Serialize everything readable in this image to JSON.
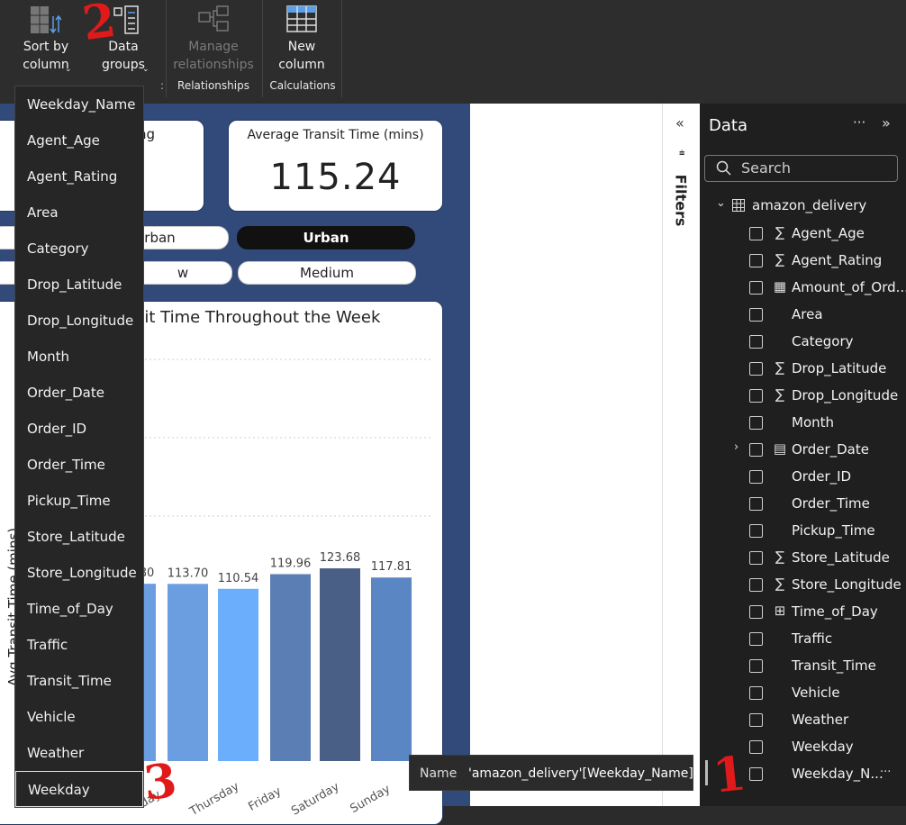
{
  "ribbon": {
    "sort_by_column": "Sort by\ncolumn",
    "data_groups": "Data\ngroups",
    "manage_relationships": "Manage\nrelationships",
    "new_column": "New\ncolumn",
    "group_relationships": "Relationships",
    "group_calculations": "Calculations"
  },
  "cards": {
    "rating_fragment": "ting",
    "avg_transit_title": "Average Transit Time (mins)",
    "avg_transit_value": "115.24"
  },
  "slicers": {
    "row1_left": "Urban",
    "row1_right": "Urban",
    "row2_left": "w",
    "row2_right": "Medium"
  },
  "chart": {
    "title_fragment": "sit Time Throughout the Week",
    "ylabel_fragment": "Avg Transit Time (mins)"
  },
  "chart_data": {
    "type": "bar",
    "title": "sit Time Throughout the Week",
    "ylabel": "Avg Transit Time (mins)",
    "categories": [
      "Wednesday",
      "Thursday",
      "Friday",
      "Saturday",
      "Sunday"
    ],
    "values": [
      113.7,
      110.54,
      119.96,
      123.68,
      117.81
    ],
    "value_labels": [
      "113.70",
      "110.54",
      "119.96",
      "123.68",
      "117.81"
    ],
    "partial_label": "80",
    "visible_tick_fragments": [
      "day",
      "Thursday",
      "Friday",
      "Saturday",
      "Sunday"
    ],
    "colors": [
      "#6b9ee0",
      "#6aaefc",
      "#5b7fb4",
      "#4a5f85",
      "#5b86c4"
    ],
    "ylim": [
      0,
      160
    ],
    "grid": true
  },
  "menu": {
    "items": [
      "Weekday_Name",
      "Agent_Age",
      "Agent_Rating",
      "Area",
      "Category",
      "Drop_Latitude",
      "Drop_Longitude",
      "Month",
      "Order_Date",
      "Order_ID",
      "Order_Time",
      "Pickup_Time",
      "Store_Latitude",
      "Store_Longitude",
      "Time_of_Day",
      "Traffic",
      "Transit_Time",
      "Vehicle",
      "Weather",
      "Weekday"
    ],
    "highlighted": "Weekday"
  },
  "filters": {
    "label": "Filters"
  },
  "data_pane": {
    "title": "Data",
    "search_placeholder": "Search",
    "table_name": "amazon_delivery",
    "fields": [
      {
        "name": "Agent_Age",
        "icon": "sigma-icon"
      },
      {
        "name": "Agent_Rating",
        "icon": "sigma-icon"
      },
      {
        "name": "Amount_of_Ord...",
        "icon": "calculator-icon"
      },
      {
        "name": "Area",
        "icon": ""
      },
      {
        "name": "Category",
        "icon": ""
      },
      {
        "name": "Drop_Latitude",
        "icon": "sigma-icon"
      },
      {
        "name": "Drop_Longitude",
        "icon": "sigma-icon"
      },
      {
        "name": "Month",
        "icon": ""
      },
      {
        "name": "Order_Date",
        "icon": "calendar-icon"
      },
      {
        "name": "Order_ID",
        "icon": ""
      },
      {
        "name": "Order_Time",
        "icon": ""
      },
      {
        "name": "Pickup_Time",
        "icon": ""
      },
      {
        "name": "Store_Latitude",
        "icon": "sigma-icon"
      },
      {
        "name": "Store_Longitude",
        "icon": "sigma-icon"
      },
      {
        "name": "Time_of_Day",
        "icon": "calc-column-icon"
      },
      {
        "name": "Traffic",
        "icon": ""
      },
      {
        "name": "Transit_Time",
        "icon": ""
      },
      {
        "name": "Vehicle",
        "icon": ""
      },
      {
        "name": "Weather",
        "icon": ""
      },
      {
        "name": "Weekday",
        "icon": ""
      },
      {
        "name": "Weekday_N...",
        "icon": ""
      }
    ]
  },
  "tooltip": {
    "label": "Name",
    "value": "'amazon_delivery'[Weekday_Name]"
  },
  "annotations": {
    "a1": "1",
    "a2": "2",
    "a3": "3",
    "color": "#e01a1a"
  }
}
